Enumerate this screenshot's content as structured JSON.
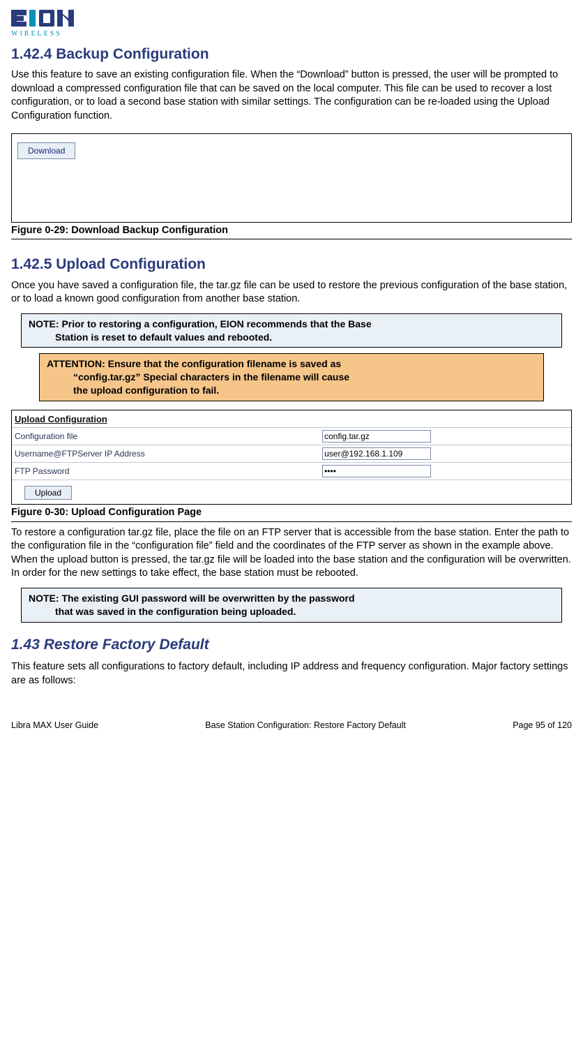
{
  "logo": {
    "brand": "EION",
    "sub": "WIRELESS"
  },
  "sections": {
    "backup": {
      "heading": "1.42.4 Backup Configuration",
      "para": "Use this feature to save an existing configuration file. When the “Download” button is pressed, the user will be prompted to download a compressed configuration file that can be saved on the local computer. This file can be used to recover a lost configuration, or to load a second base station with similar settings. The configuration can be re-loaded using the Upload Configuration function.",
      "download_label": "Download",
      "figcap": "Figure 0-29: Download Backup Configuration"
    },
    "upload": {
      "heading": "1.42.5 Upload Configuration",
      "para1": "Once you have saved a configuration file, the tar.gz file can be used to restore the previous configuration of the base station, or to load a known good configuration from another base station.",
      "note1_line1": "NOTE: Prior to restoring a configuration, EION recommends that the Base",
      "note1_line2": "Station is reset to default values and rebooted.",
      "attn_line1": "ATTENTION: Ensure that the configuration filename is saved as",
      "attn_line2": "“config.tar.gz” Special characters in the filename will cause",
      "attn_line3": "the upload configuration to fail.",
      "panel_title": "Upload Configuration",
      "fields": {
        "cfg_label": "Configuration file",
        "cfg_value": "config.tar.gz",
        "user_label": "Username@FTPServer IP Address",
        "user_value": "user@192.168.1.109",
        "pw_label": "FTP Password",
        "pw_value": "••••"
      },
      "upload_label": "Upload",
      "figcap": "Figure 0-30: Upload Configuration Page",
      "para2": "To restore a configuration tar.gz file, place the file on an FTP server that is accessible from the base station. Enter the path to the configuration file in the “configuration file” field and the coordinates of the FTP server as shown in the example above. When the upload button is pressed, the tar.gz file will be loaded into the base station and the configuration will be overwritten. In order for the new settings to take effect, the base station must be rebooted.",
      "note2_line1": "NOTE: The existing GUI password will be overwritten by the password",
      "note2_line2": "that was saved in the configuration being uploaded."
    },
    "restore": {
      "heading": "1.43 Restore Factory Default",
      "para": "This feature sets all configurations to factory default, including IP address and frequency configuration. Major factory settings are as follows:"
    }
  },
  "footer": {
    "left": "Libra MAX User Guide",
    "center": "Base Station Configuration: Restore Factory Default",
    "right": "Page 95 of 120"
  }
}
